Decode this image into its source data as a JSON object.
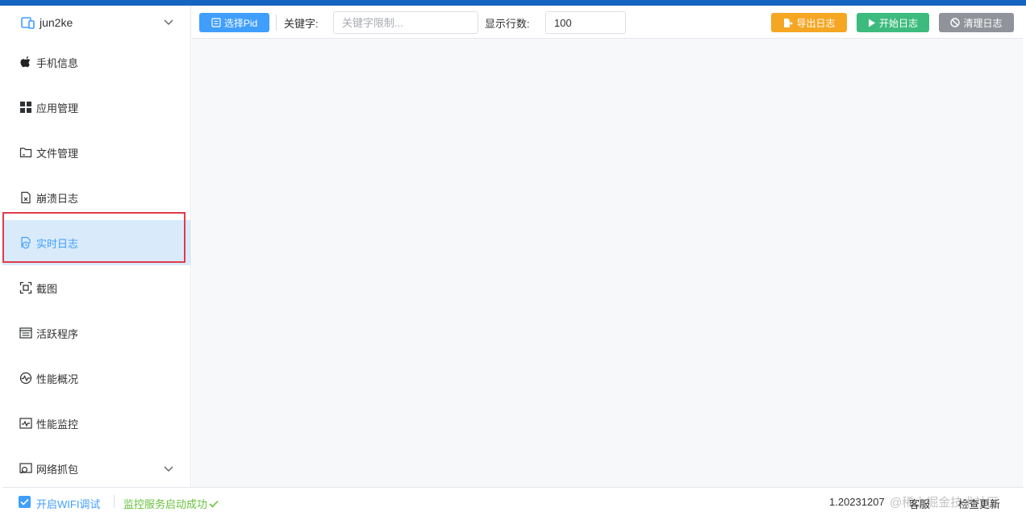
{
  "device": {
    "name": "jun2ke",
    "icon": "device-icon"
  },
  "sidebar": {
    "items": [
      {
        "label": "手机信息",
        "icon": "apple-icon"
      },
      {
        "label": "应用管理",
        "icon": "apps-grid-icon"
      },
      {
        "label": "文件管理",
        "icon": "folder-icon"
      },
      {
        "label": "崩溃日志",
        "icon": "crash-file-icon"
      },
      {
        "label": "实时日志",
        "icon": "realtime-log-icon",
        "active": true
      },
      {
        "label": "截图",
        "icon": "screenshot-icon"
      },
      {
        "label": "活跃程序",
        "icon": "process-list-icon"
      },
      {
        "label": "性能概况",
        "icon": "performance-icon"
      },
      {
        "label": "性能监控",
        "icon": "monitor-icon"
      },
      {
        "label": "网络抓包",
        "icon": "network-capture-icon"
      }
    ]
  },
  "toolbar": {
    "select_pid_label": "选择Pid",
    "keyword_label": "关键字:",
    "keyword_placeholder": "关键字限制...",
    "keyword_value": "",
    "rows_label": "显示行数:",
    "rows_value": "100",
    "export_label": "导出日志",
    "start_label": "开始日志",
    "clear_label": "清理日志"
  },
  "colors": {
    "accent": "#409eff",
    "export": "#f5a623",
    "start": "#3dbb7e",
    "clear": "#909399",
    "success": "#67c23a",
    "highlight_border": "#e03c4b"
  },
  "status": {
    "wifi_debug_label": "开启WIFI调试",
    "wifi_debug_checked": true,
    "service_status": "监控服务启动成功",
    "version": "1.20231207",
    "service_link": "客服",
    "check_update": "检查更新",
    "watermark": "@稀土掘金技术社区"
  }
}
